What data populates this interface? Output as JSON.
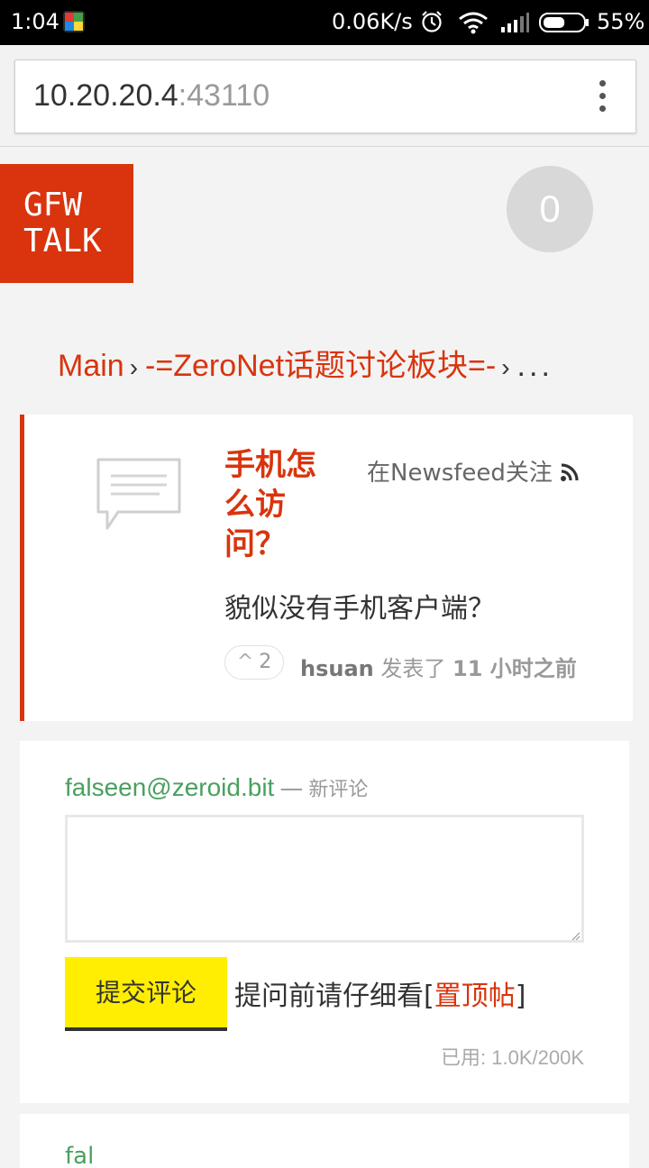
{
  "status_bar": {
    "time": "1:04",
    "network_speed": "0.06K/s",
    "battery_percent": "55%",
    "battery_level": 0.55
  },
  "browser": {
    "url_host": "10.20.20.4",
    "url_port": ":43110"
  },
  "site": {
    "logo_line1": "GFW",
    "logo_line2": "TALK",
    "badge_count": "0",
    "accent_color": "#d9340d"
  },
  "breadcrumb": {
    "items": [
      "Main",
      "-=ZeroNet话题讨论板块=-"
    ],
    "separator": "›",
    "ellipsis": "..."
  },
  "topic": {
    "title": "手机怎么访问？",
    "follow_label": "在Newsfeed关注",
    "body": "貌似没有手机客户端？",
    "vote_count": "2",
    "vote_arrow": "^",
    "author": "hsuan",
    "posted_prefix": "发表了",
    "posted_when": "11 小时之前"
  },
  "comment_form": {
    "user": "falseen@zeroid.bit",
    "dash": "—",
    "new_comment_label": "新评论",
    "textarea_value": "",
    "submit_label": "提交评论",
    "hint_prefix": "提问前请仔细看[",
    "hint_link": "置顶帖",
    "hint_suffix": "]",
    "usage": "已用: 1.0K/200K"
  },
  "next_comment": {
    "user_peek": "fal"
  }
}
